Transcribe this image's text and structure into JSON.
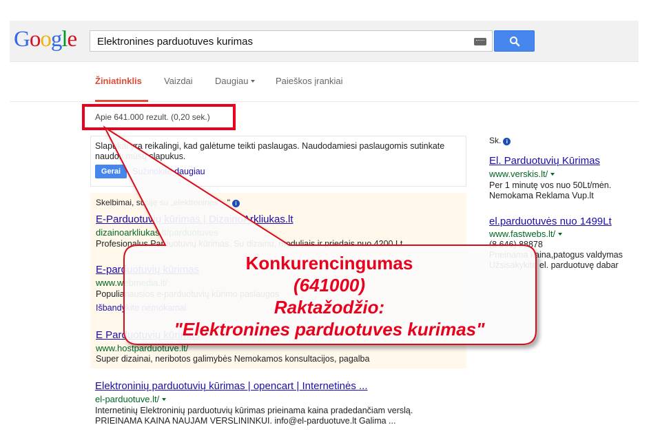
{
  "header": {
    "logo_letters": [
      {
        "ch": "G",
        "color": "#3369e8"
      },
      {
        "ch": "o",
        "color": "#d50f25"
      },
      {
        "ch": "o",
        "color": "#eeb211"
      },
      {
        "ch": "g",
        "color": "#3369e8"
      },
      {
        "ch": "l",
        "color": "#009925"
      },
      {
        "ch": "e",
        "color": "#d50f25"
      }
    ],
    "search_value": "Elektronines parduotuves kurimas",
    "keyboard_icon": "keyboard-icon",
    "search_icon": "search-icon"
  },
  "tabs": {
    "web": "Žiniatinklis",
    "images": "Vaizdai",
    "more": "Daugiau",
    "tools": "Paieškos įrankiai"
  },
  "stats": "Apie 641.000 rezult. (0,20 sek.)",
  "cookie": {
    "text": "Slapukai yra reikalingi, kad galėtume teikti paslaugas. Naudodamiesi paslaugomis sutinkate naudoti mūsų slapukus.",
    "ok_label": "Gerai",
    "more_label": "Sužinokite daugiau"
  },
  "ads": {
    "label": "Skelbimai, susiję su „elektronines ...\"",
    "items": [
      {
        "title": "E-Parduotuvių kūrimas | DizainoArkliukas.lt",
        "url": "dizainoarkliukas.lt/parduotuves",
        "desc": "Profesionalus Parduotuvių kūrimas. Su dizainu, moduliais ir priedais nuo 4200 Lt"
      },
      {
        "title": "E-parduotuvių kūrimas",
        "url": "www.webmedia.lt/",
        "desc": "Populiariausios e-parduotuvių kūrimo paslaugos",
        "sub": "Išbandykite nemokamai"
      },
      {
        "title": "E Parduotuvių kūrimas",
        "url": "www.hostparduotuve.lt/",
        "desc": "Super dizainai, neribotos galimybės Nemokamos konsultacijos, pagalba"
      }
    ]
  },
  "organic": {
    "title": "Elektroninių parduotuvių kūrimas | opencart | Internetinės ...",
    "url": "el-parduotuve.lt/",
    "desc1": "Internetinių Elektroninių parduotuvių kūrimas prieinama kaina pradedančiam verslą.",
    "desc2": "PRIEINAMA KAINA NAUJAM VERSLININKUI. info@el-parduotuve.lt Galima ..."
  },
  "right_ads": {
    "label": "Sk.",
    "items": [
      {
        "title": "El. Parduotuvių Kūrimas",
        "url": "www.verskis.lt/",
        "desc1": "Per 1 minutę vos nuo 50Lt/mėn.",
        "desc2": "Nemokama Reklama Vup.lt"
      },
      {
        "title": "el.parduotuvės nuo 1499Lt",
        "url": "www.fastwebs.lt/",
        "desc1": "(8 646) 88878",
        "desc2": "Prieinama kaina,patogus valdymas",
        "desc3": "Užsisakykite el. parduotuvę dabar"
      }
    ]
  },
  "callout": {
    "line1": "Konkurencingumas",
    "line2": "(641000)",
    "line3": "Raktažodžio:",
    "line4": "\"Elektronines parduotuves kurimas\"",
    "color": "#e8001c"
  }
}
